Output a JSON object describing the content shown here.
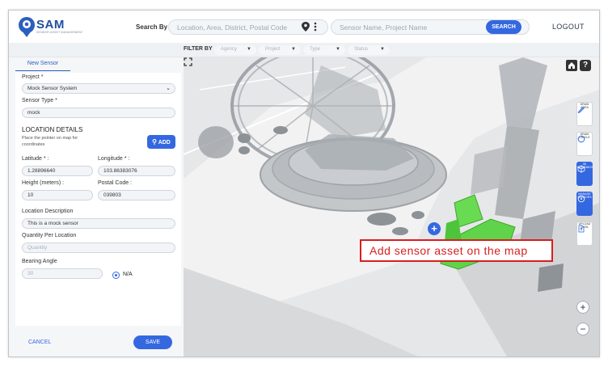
{
  "header": {
    "logo_text": "SAM",
    "logo_subtitle": "SENSOR ASSET MANAGEMENT",
    "search_by_label": "Search By",
    "location_placeholder": "Location, Area, District, Postal Code",
    "sensor_placeholder": "Sensor Name, Project Name",
    "search_button": "SEARCH",
    "logout": "LOGOUT"
  },
  "filter": {
    "label": "FILTER BY",
    "selects": [
      "Agency",
      "Project",
      "Type",
      "Status"
    ]
  },
  "panel": {
    "tab": "New Sensor",
    "project_label": "Project *",
    "project_value": "Mock Sensor System",
    "sensor_type_label": "Sensor Type *",
    "sensor_type_value": "mock",
    "location_details": "LOCATION DETAILS",
    "location_hint": "Place the pointer on map for coordinates",
    "add_button": "ADD",
    "latitude_label": "Latitude * :",
    "latitude_value": "1.28896640",
    "longitude_label": "Longitude * :",
    "longitude_value": "103.86383076",
    "height_label": "Height (meters) :",
    "height_value": "10",
    "postal_label": "Postal Code :",
    "postal_value": "039803",
    "desc_label": "Location Description",
    "desc_value": "This is a mock sensor",
    "qty_label": "Quantity Per Location",
    "qty_placeholder": "Quantity",
    "bearing_label": "Bearing Angle",
    "bearing_placeholder": "30",
    "na_label": "N/A",
    "cancel": "CANCEL",
    "save": "SAVE"
  },
  "map": {
    "help": "?",
    "tools": [
      {
        "icon": "pencil-icon",
        "label": "DRAW AREA"
      },
      {
        "icon": "circle-icon",
        "label": "DRAW CIRCLE"
      },
      {
        "icon": "cube-icon",
        "label": "3D BUILDINGS",
        "active": true
      },
      {
        "icon": "sensor-icon",
        "label": "MANAGE SENSORS",
        "active": true
      },
      {
        "icon": "upload-icon",
        "label": "UPLOAD DATA"
      }
    ],
    "zoom_in": "+",
    "zoom_out": "−",
    "marker": "+",
    "callout": "Add sensor asset on the map"
  },
  "colors": {
    "accent": "#3468e0",
    "callout": "#d81e1e",
    "highlight": "#5fd44a"
  }
}
